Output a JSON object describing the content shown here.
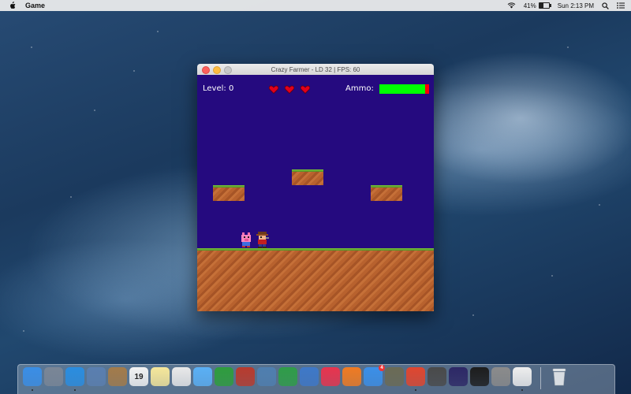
{
  "menubar": {
    "app_name": "Game",
    "battery": "41%",
    "clock": "Sun 2:13 PM"
  },
  "window": {
    "title": "Crazy Farmer - LD 32 | FPS: 60"
  },
  "game": {
    "level_label": "Level: 0",
    "ammo_label": "Ammo:",
    "ammo_fraction": 0.92,
    "hearts": 3,
    "colors": {
      "sky": "#250a7f",
      "ammo_full": "#00ff00",
      "ammo_empty": "#ff0000",
      "heart": "#e0001b"
    }
  },
  "dock": {
    "apps": [
      {
        "icon": "finder-icon",
        "color": "#3a8ee6",
        "running": true
      },
      {
        "icon": "launchpad-icon",
        "color": "#7a8696",
        "running": false
      },
      {
        "icon": "safari-icon",
        "color": "#2a8de0",
        "running": true
      },
      {
        "icon": "preview-icon",
        "color": "#5a7fb0",
        "running": false
      },
      {
        "icon": "contacts-icon",
        "color": "#a37b4a",
        "running": false
      },
      {
        "icon": "calendar-icon",
        "color": "#f3f3f3",
        "running": false,
        "label": "19"
      },
      {
        "icon": "notes-icon",
        "color": "#f6e79b",
        "running": false
      },
      {
        "icon": "reminders-icon",
        "color": "#e9e9e9",
        "running": false
      },
      {
        "icon": "messages-icon",
        "color": "#5ab0f5",
        "running": false
      },
      {
        "icon": "facetime-icon",
        "color": "#2e9d3d",
        "running": false
      },
      {
        "icon": "photo-booth-icon",
        "color": "#b83b2e",
        "running": false
      },
      {
        "icon": "iphoto-icon",
        "color": "#4f7fb0",
        "running": false
      },
      {
        "icon": "numbers-icon",
        "color": "#2f9d48",
        "running": false
      },
      {
        "icon": "keynote-icon",
        "color": "#3e78c8",
        "running": false
      },
      {
        "icon": "itunes-icon",
        "color": "#e8344e",
        "running": false
      },
      {
        "icon": "ibooks-icon",
        "color": "#f07b22",
        "running": false
      },
      {
        "icon": "app-store-icon",
        "color": "#3b8fe8",
        "running": false,
        "badge": "4"
      },
      {
        "icon": "gimp-icon",
        "color": "#6b6b55",
        "running": false
      },
      {
        "icon": "chrome-icon",
        "color": "#e0462f",
        "running": true
      },
      {
        "icon": "sublime-text-icon",
        "color": "#4a4a4a",
        "running": false
      },
      {
        "icon": "eclipse-icon",
        "color": "#2d2866",
        "running": false
      },
      {
        "icon": "terminal-icon",
        "color": "#1d1d1d",
        "running": false
      },
      {
        "icon": "system-preferences-icon",
        "color": "#8b8b8b",
        "running": false
      },
      {
        "icon": "java-icon",
        "color": "#eeeeee",
        "running": true
      }
    ],
    "trash": {
      "icon": "trash-icon",
      "color": "#d8dde2"
    }
  }
}
